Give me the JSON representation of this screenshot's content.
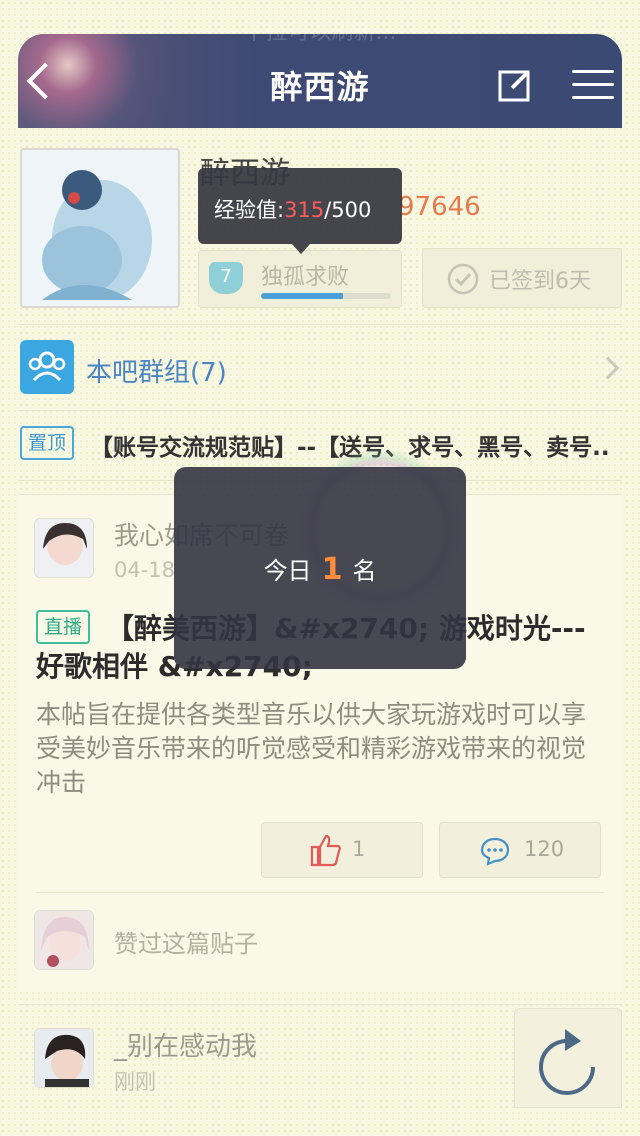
{
  "header": {
    "title": "醉西游",
    "ghost_text": "下拉可以刷新..."
  },
  "profile": {
    "forum_name": "醉西游",
    "member_count_visible": "97646",
    "level_number": "7",
    "level_name": "独孤求败",
    "exp_progress": 0.63,
    "signin_label": "已签到6天"
  },
  "tooltip": {
    "label": "经验值:",
    "current": "315",
    "total": "/500"
  },
  "group": {
    "label": "本吧群组(7)"
  },
  "pinned": {
    "tag": "置顶",
    "title": "【账号交流规范贴】--【送号、求号、黑号、卖号.."
  },
  "post": {
    "author": "我心如席不可卷",
    "date": "04-18",
    "tag": "直播",
    "title": "【醉美西游】&#x2740; 游戏时光---好歌相伴 &#x2740;",
    "body": "本帖旨在提供各类型音乐以供大家玩游戏时可以享受美妙音乐带来的听觉感受和精彩游戏带来的视觉冲击",
    "likes": "1",
    "comments": "120",
    "likers_text": "赞过这篇贴子"
  },
  "next_post": {
    "author": "_别在感动我",
    "time": "刚刚"
  },
  "toast": {
    "prefix": "今日",
    "rank": "1",
    "suffix": "名"
  },
  "colors": {
    "accent_blue": "#3ba7e0",
    "accent_orange": "#e77a4c",
    "header_bg": "#3e4a74",
    "page_bg": "#f8f7e1"
  }
}
